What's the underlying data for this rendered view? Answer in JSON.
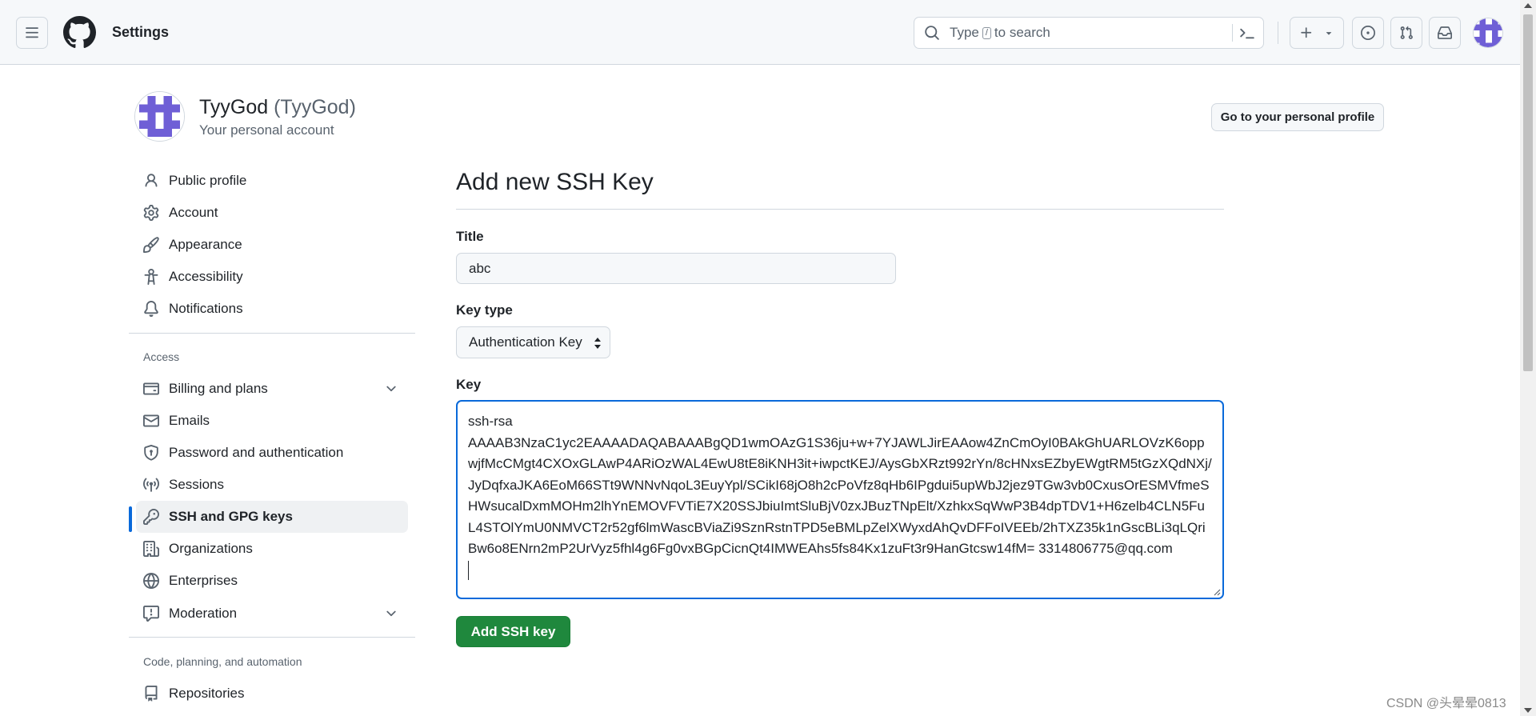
{
  "header": {
    "context_title": "Settings",
    "search": {
      "prefix": "Type",
      "key": "/",
      "suffix": "to search"
    }
  },
  "profile": {
    "name": "TyyGod",
    "login": "(TyyGod)",
    "subtitle": "Your personal account",
    "profile_button": "Go to your personal profile"
  },
  "sidebar": {
    "items": [
      {
        "label": "Public profile",
        "icon": "person-icon"
      },
      {
        "label": "Account",
        "icon": "gear-icon"
      },
      {
        "label": "Appearance",
        "icon": "paintbrush-icon"
      },
      {
        "label": "Accessibility",
        "icon": "accessibility-icon"
      },
      {
        "label": "Notifications",
        "icon": "bell-icon"
      }
    ],
    "access_heading": "Access",
    "access_items": [
      {
        "label": "Billing and plans",
        "icon": "credit-card-icon"
      },
      {
        "label": "Emails",
        "icon": "mail-icon"
      },
      {
        "label": "Password and authentication",
        "icon": "shield-lock-icon"
      },
      {
        "label": "Sessions",
        "icon": "broadcast-icon"
      },
      {
        "label": "SSH and GPG keys",
        "icon": "key-icon"
      },
      {
        "label": "Organizations",
        "icon": "organization-icon"
      },
      {
        "label": "Enterprises",
        "icon": "globe-icon"
      },
      {
        "label": "Moderation",
        "icon": "report-icon"
      }
    ],
    "code_heading": "Code, planning, and automation",
    "code_items": [
      {
        "label": "Repositories",
        "icon": "repo-icon"
      }
    ]
  },
  "main": {
    "page_title": "Add new SSH Key",
    "title_label": "Title",
    "title_value": "abc",
    "key_type_label": "Key type",
    "key_type_value": "Authentication Key",
    "key_label": "Key",
    "key_value": "ssh-rsa\nAAAAB3NzaC1yc2EAAAADAQABAAABgQD1wmOAzG1S36ju+w+7YJAWLJirEAAow4ZnCmOyI0BAkGhUARLOVzK6oppwjfMcCMgt4CXOxGLAwP4ARiOzWAL4EwU8tE8iKNH3it+iwpctKEJ/AysGbXRzt992rYn/8cHNxsEZbyEWgtRM5tGzXQdNXj/JyDqfxaJKA6EoM66STt9WNNvNqoL3EuyYpl/SCikI68jO8h2cPoVfz8qHb6IPgdui5upWbJ2jez9TGw3vb0CxusOrESMVfmeSHWsucalDxmMOHm2lhYnEMOVFVTiE7X20SSJbiuImtSluBjV0zxJBuzTNpElt/XzhkxSqWwP3B4dpTDV1+H6zelb4CLN5FuL4STOlYmU0NMVCT2r52gf6lmWascBViaZi9SznRstnTPD5eBMLpZelXWyxdAhQvDFFoIVEEb/2hTXZ35k1nGscBLi3qLQriBw6o8ENrn2mP2UrVyz5fhl4g6Fg0vxBGpCicnQt4IMWEAhs5fs84Kx1zuFt3r9HanGtcsw14fM= 3314806775@qq.com",
    "submit_label": "Add SSH key"
  },
  "watermark": "CSDN @头晕晕0813"
}
